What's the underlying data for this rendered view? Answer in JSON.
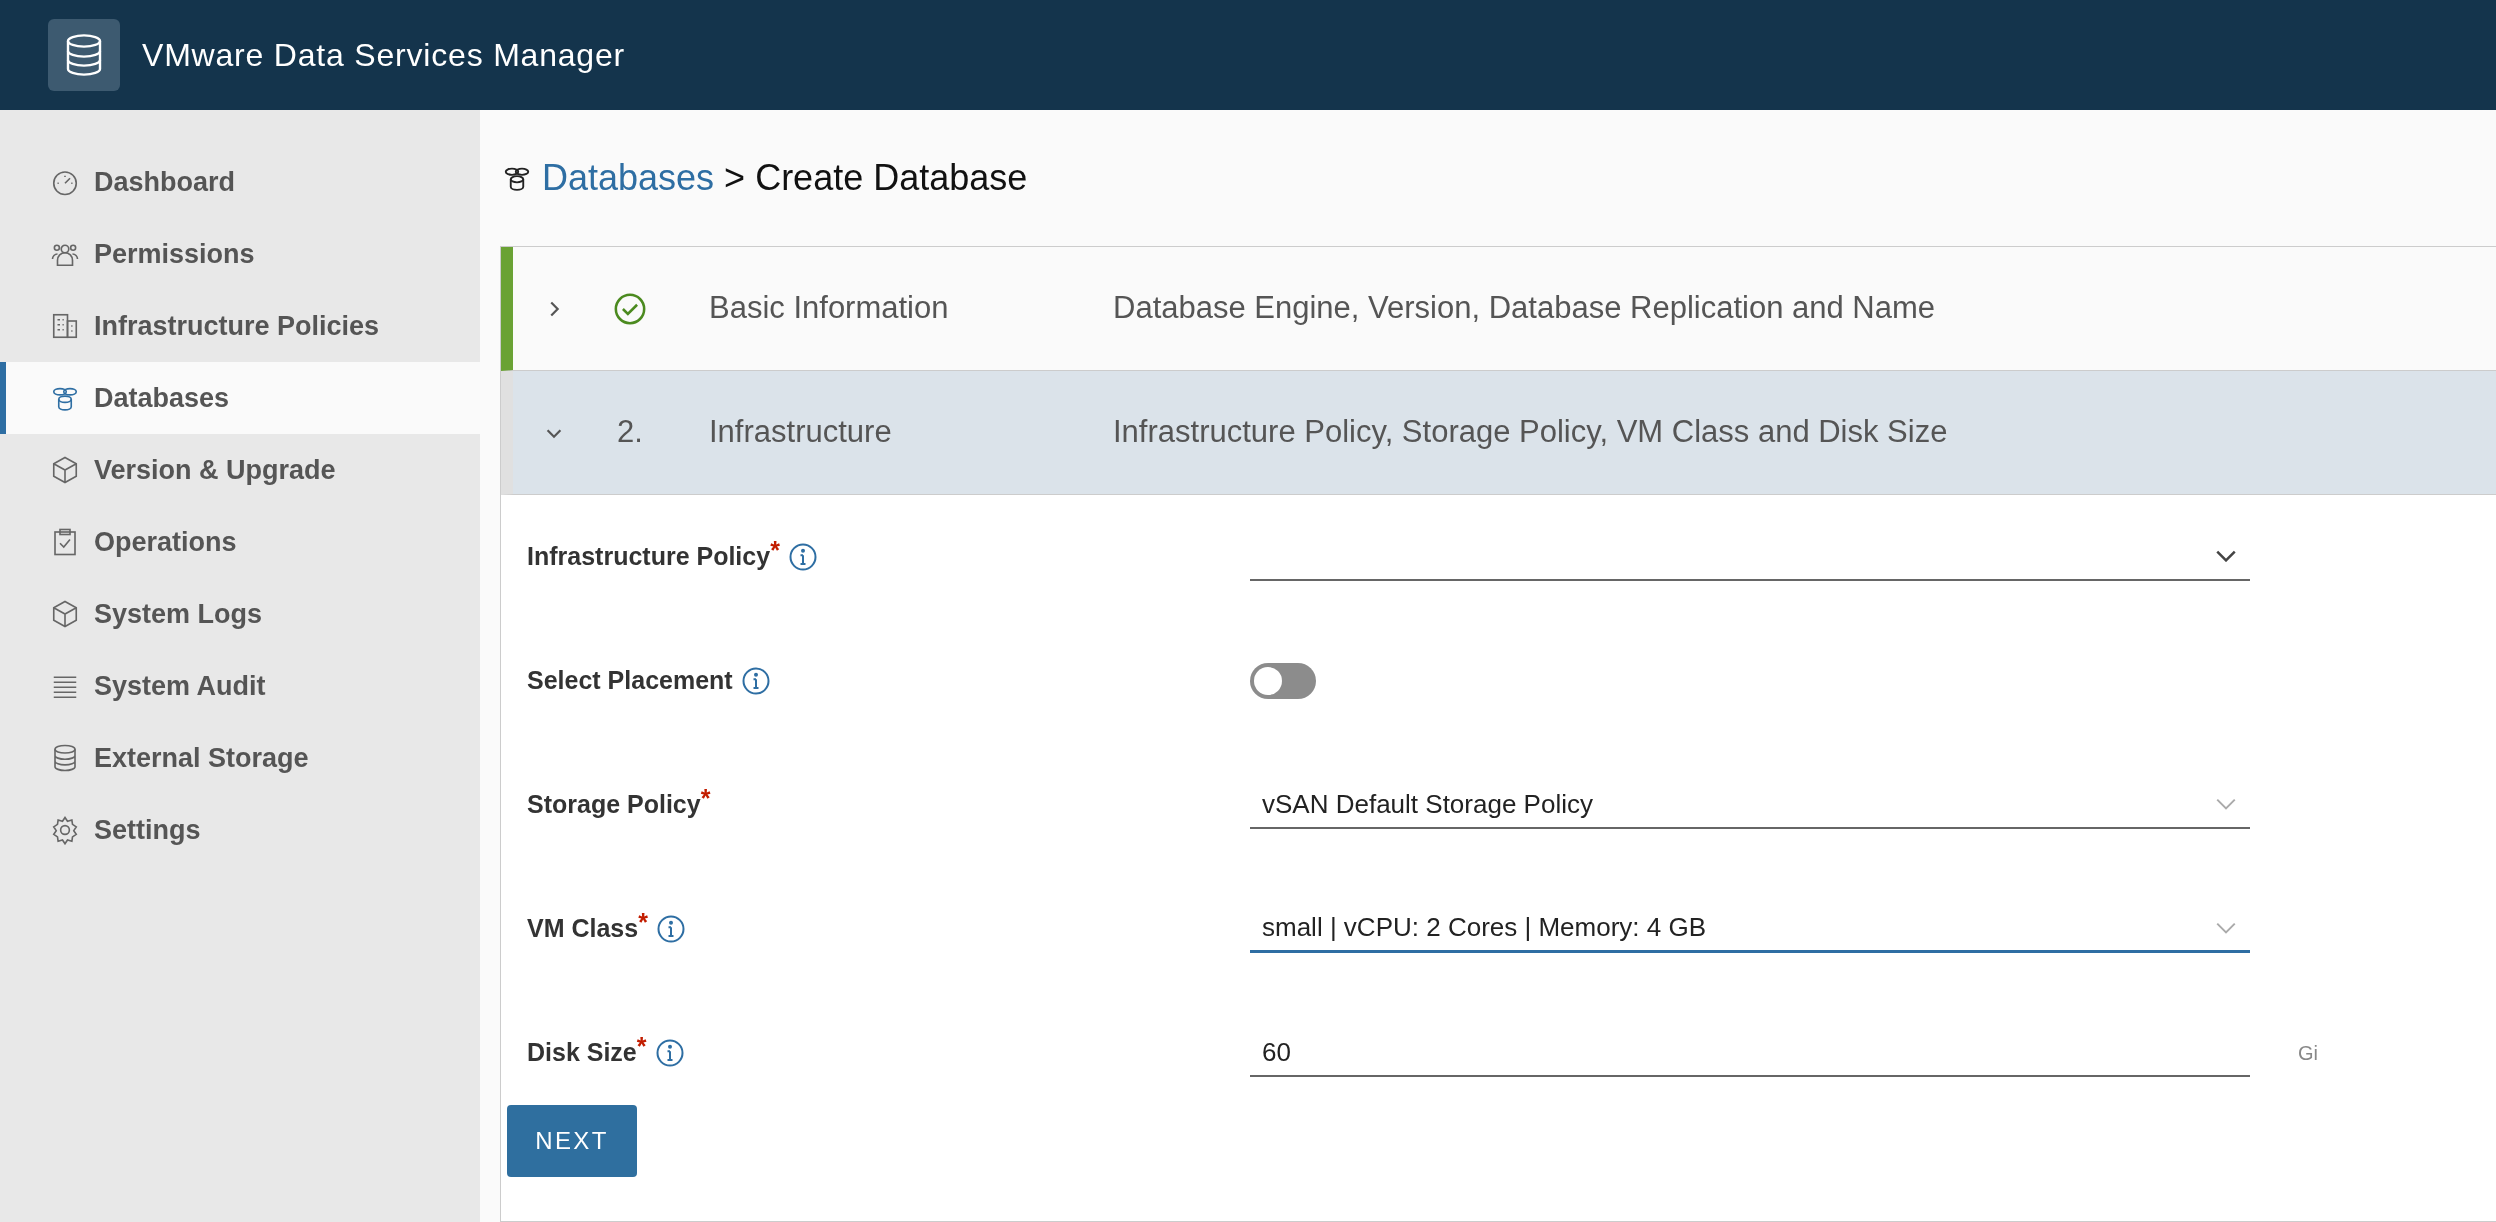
{
  "header": {
    "title": "VMware Data Services Manager"
  },
  "sidebar": {
    "items": [
      {
        "label": "Dashboard",
        "selected": false
      },
      {
        "label": "Permissions",
        "selected": false
      },
      {
        "label": "Infrastructure Policies",
        "selected": false
      },
      {
        "label": "Databases",
        "selected": true
      },
      {
        "label": "Version & Upgrade",
        "selected": false
      },
      {
        "label": "Operations",
        "selected": false
      },
      {
        "label": "System Logs",
        "selected": false
      },
      {
        "label": "System Audit",
        "selected": false
      },
      {
        "label": "External Storage",
        "selected": false
      },
      {
        "label": "Settings",
        "selected": false
      }
    ]
  },
  "breadcrumb": {
    "link": "Databases",
    "separator": ">",
    "current": "Create Database"
  },
  "steps": [
    {
      "kind": "complete",
      "title": "Basic Information",
      "description": "Database Engine, Version, Database Replication and Name",
      "expanded": false
    },
    {
      "kind": "number",
      "number": "2.",
      "title": "Infrastructure",
      "description": "Infrastructure Policy, Storage Policy, VM Class and Disk Size",
      "expanded": true
    }
  ],
  "form": {
    "fields": [
      {
        "kind": "select",
        "label": "Infrastructure Policy",
        "required_mark": "*",
        "info": true,
        "focused": false
      },
      {
        "kind": "toggle",
        "label": "Select Placement",
        "info": true,
        "on": false
      },
      {
        "kind": "select",
        "label": "Storage Policy",
        "required_mark": "*",
        "info": false,
        "value": "vSAN Default Storage Policy",
        "focused": false
      },
      {
        "kind": "select",
        "label": "VM Class",
        "required_mark": "*",
        "info": true,
        "value": "small | vCPU: 2 Cores | Memory: 4 GB",
        "focused": true
      },
      {
        "kind": "input",
        "label": "Disk Size",
        "required_mark": "*",
        "info": true,
        "value": "60",
        "suffix": "Gi",
        "focused": false
      }
    ],
    "next_button": "NEXT"
  }
}
